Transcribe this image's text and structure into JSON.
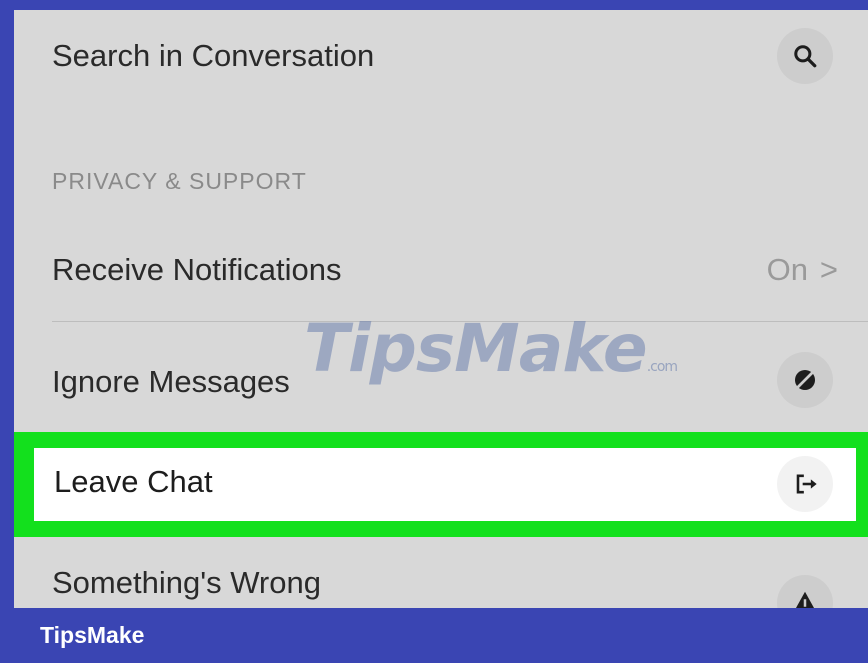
{
  "menu": {
    "search": {
      "label": "Search in Conversation",
      "icon": "search-icon"
    },
    "section_header": "PRIVACY & SUPPORT",
    "notifications": {
      "label": "Receive Notifications",
      "value": "On",
      "chevron": ">"
    },
    "ignore": {
      "label": "Ignore Messages",
      "icon": "eye-slash-icon"
    },
    "leave": {
      "label": "Leave Chat",
      "icon": "leave-chat-icon"
    },
    "wrong": {
      "label": "Something's Wrong",
      "icon": "warning-icon"
    }
  },
  "watermark": {
    "main": "TipsMake",
    "suffix": ".com"
  },
  "footer": {
    "brand": "TipsMake"
  },
  "colors": {
    "frame": "#3a45b3",
    "highlight": "#13e01d",
    "screen": "#d8d8d8"
  }
}
